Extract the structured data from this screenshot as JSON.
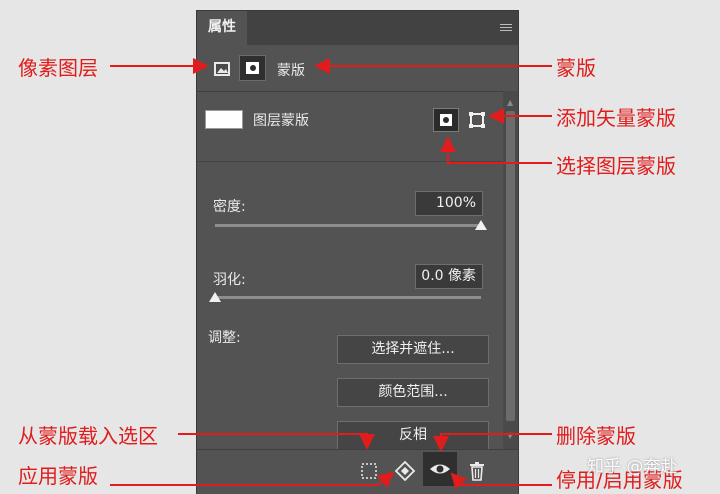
{
  "panel": {
    "tab_title": "属性",
    "header_label": "蒙版",
    "layer_mask_label": "图层蒙版"
  },
  "density": {
    "label": "密度:",
    "value": "100%",
    "level": 1.0
  },
  "feather": {
    "label": "羽化:",
    "value": "0.0 像素",
    "level": 0.0
  },
  "adjust": {
    "label": "调整:",
    "buttons": [
      "选择并遮住...",
      "颜色范围...",
      "反相"
    ]
  },
  "annotations": {
    "pixel_layer": "像素图层",
    "mask": "蒙版",
    "add_vector_mask": "添加矢量蒙版",
    "select_layer_mask": "选择图层蒙版",
    "load_selection": "从蒙版载入选区",
    "delete_mask": "删除蒙版",
    "apply_mask": "应用蒙版",
    "toggle_mask": "停用/启用蒙版"
  },
  "watermark": "知乎 @奔赴",
  "colors": {
    "annotation": "#e01c1c",
    "panel_bg": "#535353"
  }
}
